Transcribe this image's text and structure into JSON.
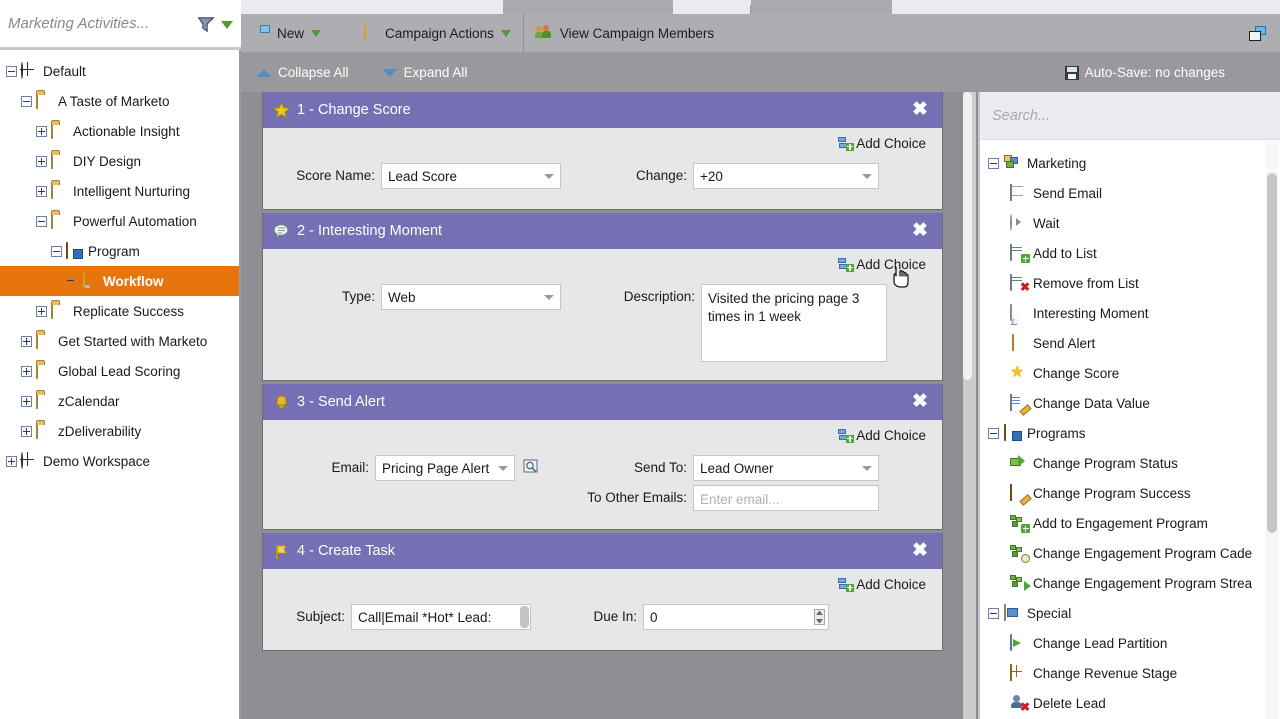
{
  "sidebar": {
    "title": "Marketing Activities...",
    "filter_icon": "funnel-icon",
    "filter_caret": "green-caret-icon",
    "tree": [
      {
        "label": "Default",
        "depth": 0,
        "icon": "globe-icon",
        "expander": "minus",
        "selected": false
      },
      {
        "label": "A Taste of Marketo",
        "depth": 1,
        "icon": "folder-icon",
        "expander": "minus",
        "selected": false
      },
      {
        "label": "Actionable Insight",
        "depth": 2,
        "icon": "folder-icon",
        "expander": "plus",
        "selected": false
      },
      {
        "label": "DIY Design",
        "depth": 2,
        "icon": "folder-icon",
        "expander": "plus",
        "selected": false
      },
      {
        "label": "Intelligent Nurturing",
        "depth": 2,
        "icon": "folder-icon",
        "expander": "plus",
        "selected": false
      },
      {
        "label": "Powerful Automation",
        "depth": 2,
        "icon": "folder-icon",
        "expander": "minus",
        "selected": false
      },
      {
        "label": "Program",
        "depth": 3,
        "icon": "program-icon",
        "expander": "minus",
        "selected": false
      },
      {
        "label": "Workflow",
        "depth": 4,
        "icon": "bulb-icon",
        "expander": "none",
        "selected": true
      },
      {
        "label": "Replicate Success",
        "depth": 2,
        "icon": "folder-icon",
        "expander": "plus",
        "selected": false
      },
      {
        "label": "Get Started with Marketo",
        "depth": 1,
        "icon": "folder-icon",
        "expander": "plus",
        "selected": false
      },
      {
        "label": "Global Lead Scoring",
        "depth": 1,
        "icon": "folder-icon",
        "expander": "plus",
        "selected": false
      },
      {
        "label": "zCalendar",
        "depth": 1,
        "icon": "folder-icon",
        "expander": "plus",
        "selected": false
      },
      {
        "label": "zDeliverability",
        "depth": 1,
        "icon": "folder-icon",
        "expander": "plus",
        "selected": false
      },
      {
        "label": "Demo Workspace",
        "depth": 0,
        "icon": "globe-icon",
        "expander": "plus",
        "selected": false
      }
    ],
    "selected_color": "#e8740c"
  },
  "toolbar": {
    "new_label": "New",
    "campaign_actions_label": "Campaign Actions",
    "view_campaign_members_label": "View Campaign Members",
    "restore_icon": "restore-window-icon"
  },
  "subbar": {
    "collapse_all_label": "Collapse All",
    "expand_all_label": "Expand All",
    "autosave_label": "Auto-Save: no changes"
  },
  "flow": {
    "add_choice_label": "Add Choice",
    "header_color": "#7570b3",
    "steps": [
      {
        "number": "1",
        "title": "1 - Change Score",
        "icon": "star-icon",
        "fields_left": [
          {
            "label": "Score Name:",
            "type": "select",
            "value": "Lead Score"
          }
        ],
        "fields_right": [
          {
            "label": "Change:",
            "type": "select",
            "value": "+20"
          }
        ]
      },
      {
        "number": "2",
        "title": "2 - Interesting Moment",
        "icon": "speech-bubble-icon",
        "fields_left": [
          {
            "label": "Type:",
            "type": "select",
            "value": "Web"
          }
        ],
        "fields_right": [
          {
            "label": "Description:",
            "type": "textarea",
            "value": "Visited the pricing page 3 times in 1 week"
          }
        ]
      },
      {
        "number": "3",
        "title": "3 - Send Alert",
        "icon": "bell-icon",
        "fields_left": [
          {
            "label": "Email:",
            "type": "select-browse",
            "value": "Pricing Page Alert"
          }
        ],
        "fields_right": [
          {
            "label": "Send To:",
            "type": "select",
            "value": "Lead Owner"
          },
          {
            "label": "To Other Emails:",
            "type": "input",
            "value": "",
            "placeholder": "Enter email..."
          }
        ]
      },
      {
        "number": "4",
        "title": "4 - Create Task",
        "icon": "flag-icon",
        "fields_left": [
          {
            "label": "Subject:",
            "type": "input-scroll",
            "value": "Call|Email *Hot* Lead:"
          }
        ],
        "fields_right": [
          {
            "label": "Due In:",
            "type": "spinner",
            "value": "0"
          }
        ]
      }
    ]
  },
  "palette": {
    "search_placeholder": "Search...",
    "groups": [
      {
        "label": "Marketing",
        "icon": "marketing-blocks-icon",
        "items": [
          {
            "label": "Send Email",
            "icon": "email-icon"
          },
          {
            "label": "Wait",
            "icon": "clock-icon"
          },
          {
            "label": "Add to List",
            "icon": "add-to-list-icon"
          },
          {
            "label": "Remove from List",
            "icon": "remove-from-list-icon"
          },
          {
            "label": "Interesting Moment",
            "icon": "speech-bubble-icon"
          },
          {
            "label": "Send Alert",
            "icon": "bell-icon"
          },
          {
            "label": "Change Score",
            "icon": "star-icon"
          },
          {
            "label": "Change Data Value",
            "icon": "data-value-icon"
          }
        ]
      },
      {
        "label": "Programs",
        "icon": "program-icon",
        "items": [
          {
            "label": "Change Program Status",
            "icon": "green-arrow-icon"
          },
          {
            "label": "Change Program Success",
            "icon": "program-edit-icon"
          },
          {
            "label": "Add to Engagement Program",
            "icon": "engagement-add-icon"
          },
          {
            "label": "Change Engagement Program Cade",
            "icon": "engagement-clock-icon"
          },
          {
            "label": "Change Engagement Program Strea",
            "icon": "engagement-arrow-icon"
          }
        ]
      },
      {
        "label": "Special",
        "icon": "special-folder-icon",
        "items": [
          {
            "label": "Change Lead Partition",
            "icon": "partition-icon"
          },
          {
            "label": "Change Revenue Stage",
            "icon": "revenue-stage-icon"
          },
          {
            "label": "Delete Lead",
            "icon": "delete-lead-icon"
          }
        ]
      }
    ]
  }
}
